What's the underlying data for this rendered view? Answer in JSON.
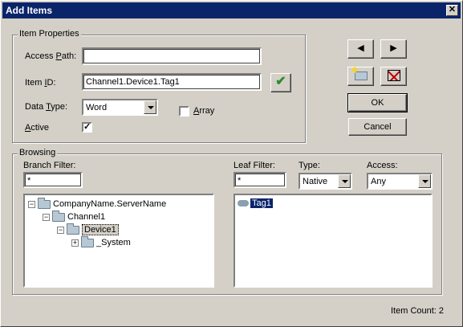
{
  "window": {
    "title": "Add Items",
    "close_glyph": "✕"
  },
  "item_properties": {
    "group_title": "Item Properties",
    "access_path": {
      "label_pre": "Access ",
      "label_u": "P",
      "label_post": "ath:",
      "value": ""
    },
    "item_id": {
      "label_pre": "Item ",
      "label_u": "I",
      "label_post": "D:",
      "value": "Channel1.Device1.Tag1"
    },
    "data_type": {
      "label_pre": "Data ",
      "label_u": "T",
      "label_post": "ype:",
      "value": "Word"
    },
    "array": {
      "label_u": "A",
      "label_post": "rray",
      "checked": false
    },
    "active": {
      "label_u": "A",
      "label_post": "ctive",
      "checked": true,
      "check_glyph": "✓"
    },
    "validate_glyph": "✔"
  },
  "side_buttons": {
    "prev_glyph": "◀",
    "next_glyph": "▶",
    "ok": "OK",
    "cancel": "Cancel"
  },
  "browsing": {
    "group_title": "Browsing",
    "branch_filter": {
      "label": "Branch Filter:",
      "value": "*"
    },
    "leaf_filter": {
      "label": "Leaf Filter:",
      "value": "*"
    },
    "type": {
      "label": "Type:",
      "value": "Native"
    },
    "access": {
      "label": "Access:",
      "value": "Any"
    },
    "tree": [
      {
        "label": "CompanyName.ServerName",
        "expander": "−"
      },
      {
        "label": "Channel1",
        "expander": "−"
      },
      {
        "label": "Device1",
        "expander": "−"
      },
      {
        "label": "_System",
        "expander": "+"
      }
    ],
    "leaves": [
      {
        "label": "Tag1"
      }
    ]
  },
  "status": {
    "item_count": "Item Count: 2"
  },
  "colors": {
    "titlebar": "#0a246a",
    "window_bg": "#d4d0c8",
    "validate_green": "#2e8b2e"
  }
}
